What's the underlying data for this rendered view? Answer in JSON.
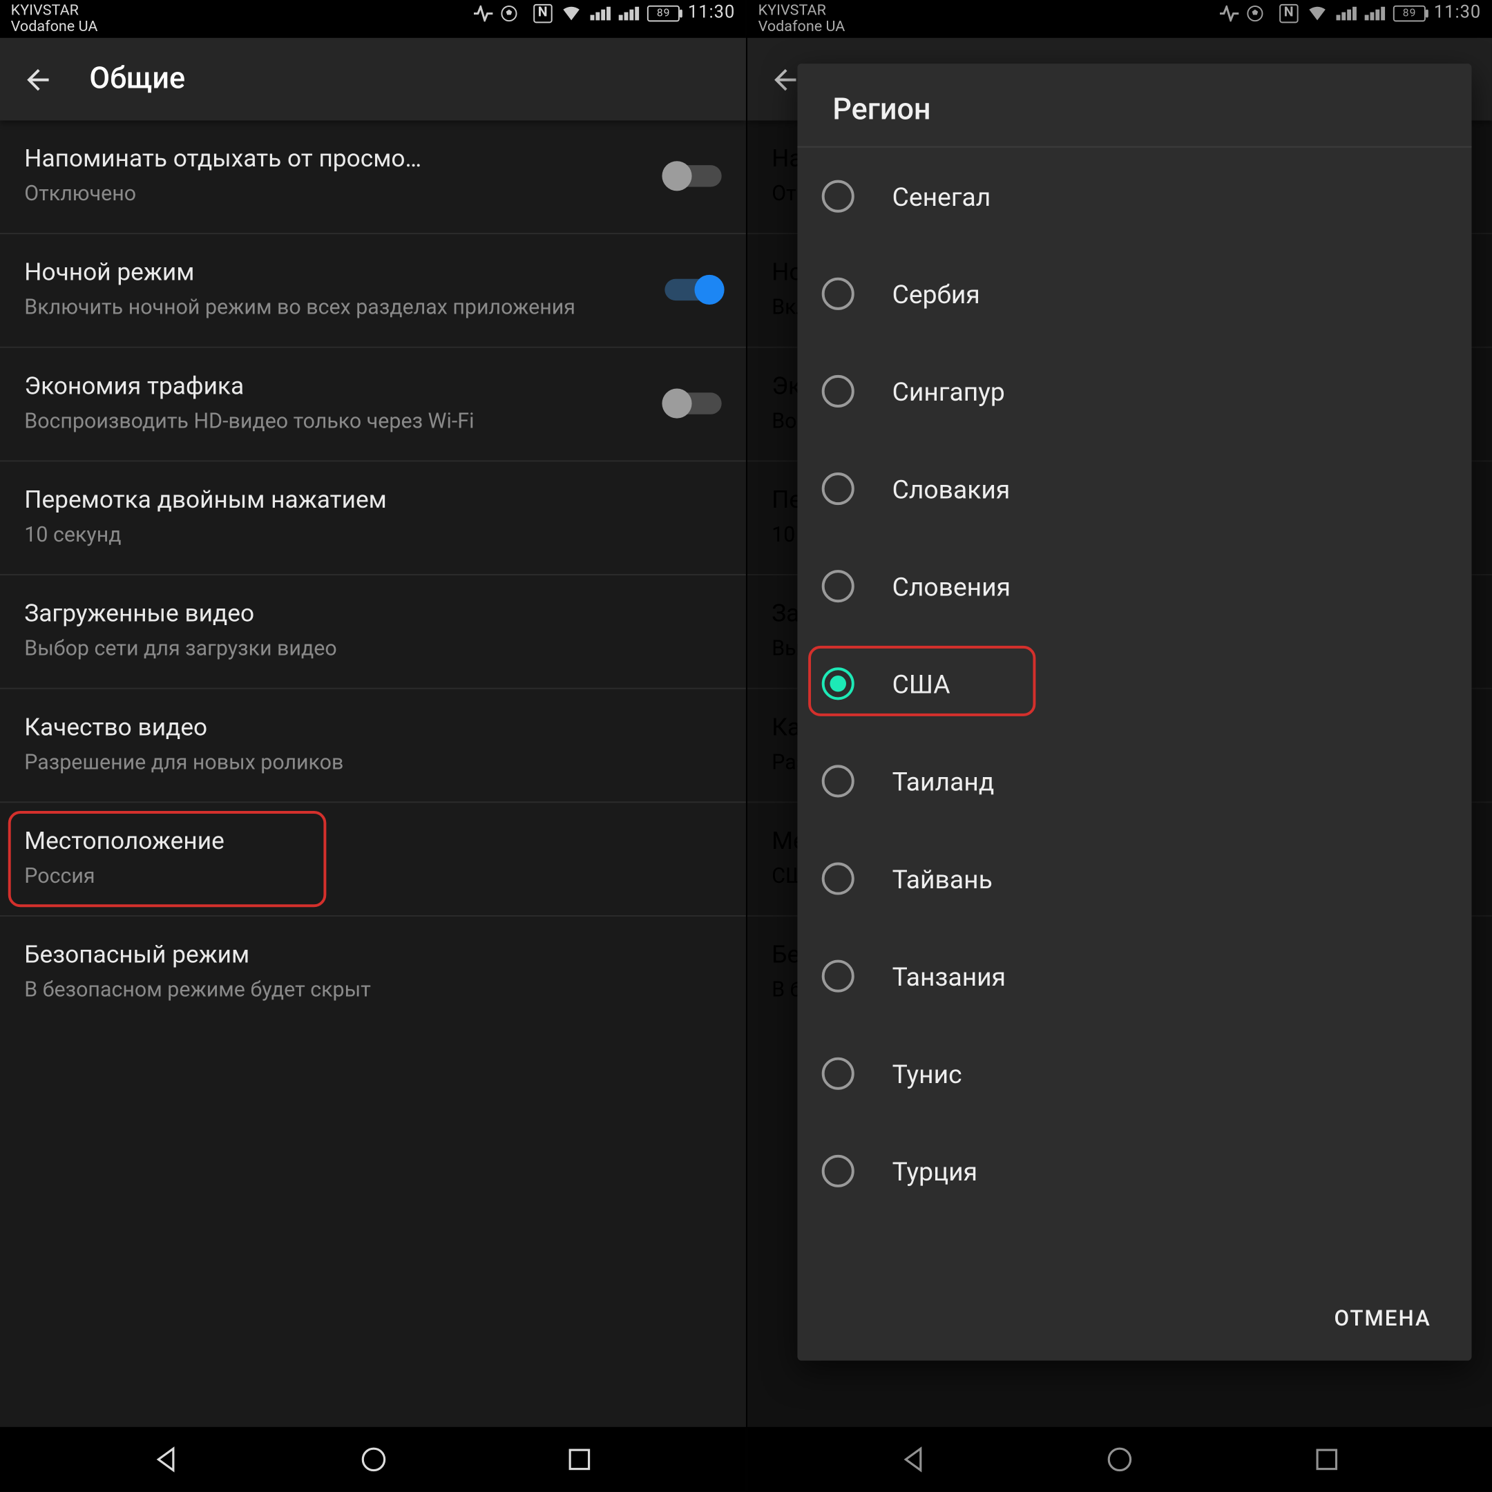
{
  "statusbar": {
    "carrier1": "KYIVSTAR",
    "carrier2": "Vodafone UA",
    "nfc": "N",
    "battery": "89",
    "time": "11:30"
  },
  "header": {
    "title": "Общие"
  },
  "rows": {
    "reminder": {
      "title": "Напоминать отдыхать от просмо…",
      "sub": "Отключено"
    },
    "night": {
      "title": "Ночной режим",
      "sub": "Включить ночной режим во всех разделах приложения"
    },
    "data": {
      "title": "Экономия трафика",
      "sub": "Воспроизводить HD-видео только через Wi-Fi"
    },
    "seek": {
      "title": "Перемотка двойным нажатием",
      "sub": "10 секунд"
    },
    "downloaded": {
      "title": "Загруженные видео",
      "sub": "Выбор сети для загрузки видео"
    },
    "quality": {
      "title": "Качество видео",
      "sub": "Разрешение для новых роликов"
    },
    "location": {
      "title": "Местоположение",
      "sub": "Россия"
    },
    "location2": {
      "sub": "США"
    },
    "safe": {
      "title": "Безопасный режим",
      "sub": "В безопасном режиме будет скрыт"
    }
  },
  "dialog": {
    "title": "Регион",
    "options": {
      "o0": "Сенегал",
      "o1": "Сербия",
      "o2": "Сингапур",
      "o3": "Словакия",
      "o4": "Словения",
      "o5": "США",
      "o6": "Таиланд",
      "o7": "Тайвань",
      "o8": "Танзания",
      "o9": "Тунис",
      "o10": "Турция"
    },
    "cancel": "ОТМЕНА"
  }
}
